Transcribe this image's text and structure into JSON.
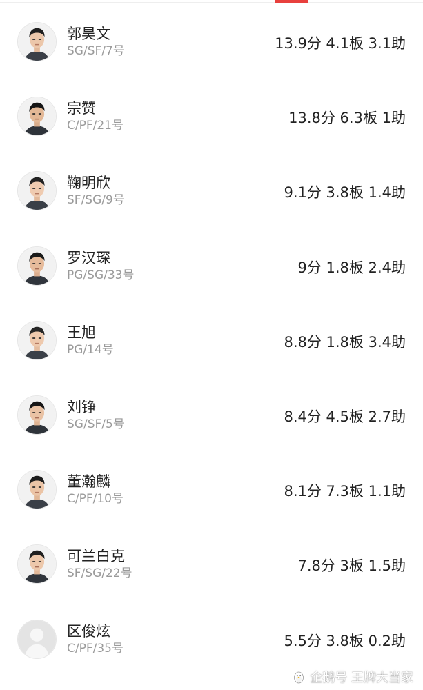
{
  "players": [
    {
      "name": "郭昊文",
      "meta": "SG/SF/7号",
      "stats": "13.9分 4.1板 3.1助",
      "photo": "face"
    },
    {
      "name": "宗赞",
      "meta": "C/PF/21号",
      "stats": "13.8分 6.3板 1助",
      "photo": "face"
    },
    {
      "name": "鞠明欣",
      "meta": "SF/SG/9号",
      "stats": "9.1分 3.8板 1.4助",
      "photo": "face"
    },
    {
      "name": "罗汉琛",
      "meta": "PG/SG/33号",
      "stats": "9分 1.8板 2.4助",
      "photo": "face"
    },
    {
      "name": "王旭",
      "meta": "PG/14号",
      "stats": "8.8分 1.8板 3.4助",
      "photo": "face"
    },
    {
      "name": "刘铮",
      "meta": "SG/SF/5号",
      "stats": "8.4分 4.5板 2.7助",
      "photo": "face"
    },
    {
      "name": "董瀚麟",
      "meta": "C/PF/10号",
      "stats": "8.1分 7.3板 1.1助",
      "photo": "face"
    },
    {
      "name": "可兰白克",
      "meta": "SF/SG/22号",
      "stats": "7.8分 3板 1.5助",
      "photo": "face"
    },
    {
      "name": "区俊炫",
      "meta": "C/PF/35号",
      "stats": "5.5分 3.8板 0.2助",
      "photo": "placeholder"
    }
  ],
  "watermark": {
    "text": "企鹅号 王牌大当家",
    "icon": "penguin-logo-icon"
  },
  "colors": {
    "accent": "#e8403d",
    "text_primary": "#222222",
    "text_secondary": "#9a9a9a"
  }
}
